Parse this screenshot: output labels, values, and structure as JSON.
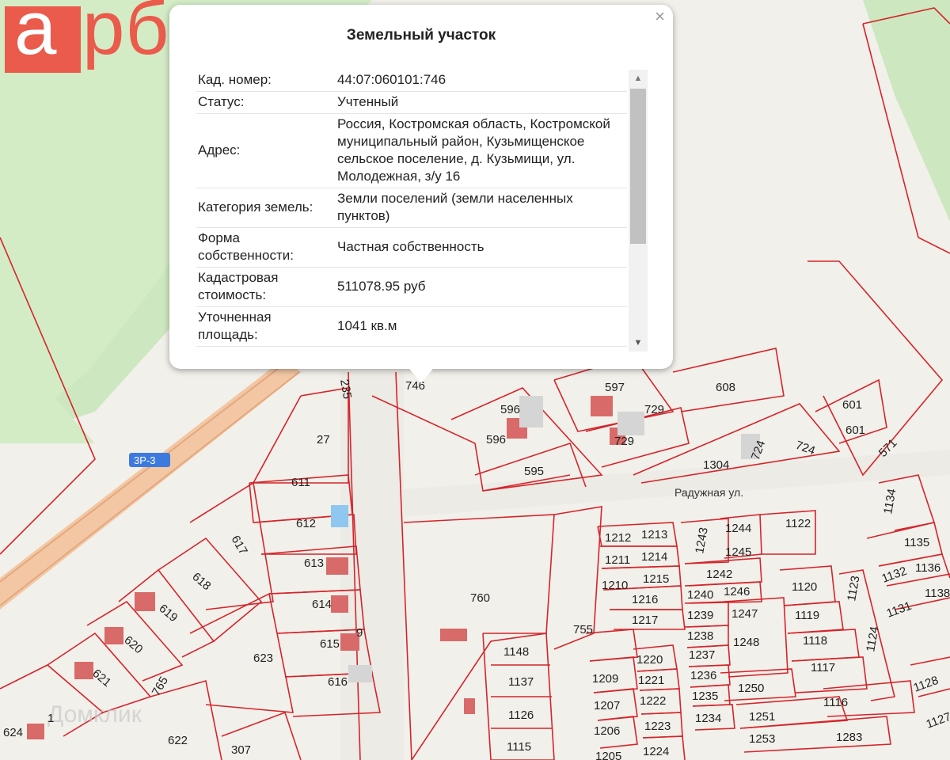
{
  "logo": {
    "first_letter": "а",
    "rest": "рбат"
  },
  "watermark": "Домклик",
  "popup": {
    "title": "Земельный участок",
    "close_glyph": "×",
    "rows": [
      {
        "key": "Кад. номер:",
        "value": "44:07:060101:746"
      },
      {
        "key": "Статус:",
        "value": "Учтенный"
      },
      {
        "key": "Адрес:",
        "value": "Россия, Костромская область, Костромской муниципальный район, Кузьмищенское сельское поселение, д. Кузьмищи, ул. Молодежная, з/у 16"
      },
      {
        "key": "Категория земель:",
        "value": "Земли поселений (земли населенных пунктов)"
      },
      {
        "key": "Форма собственности:",
        "value": "Частная собственность"
      },
      {
        "key": "Кадастровая стоимость:",
        "value": "511078.95 руб"
      },
      {
        "key": "Уточненная площадь:",
        "value": "1041 кв.м"
      }
    ]
  },
  "map": {
    "street": "Радужная ул.",
    "road_badge": "3Р-3",
    "plots": [
      "746",
      "235",
      "27",
      "611",
      "612",
      "613",
      "614",
      "615",
      "616",
      "617",
      "618",
      "619",
      "620",
      "621",
      "622",
      "623",
      "624",
      "307",
      "760",
      "755",
      "596",
      "596",
      "595",
      "597",
      "729",
      "729",
      "608",
      "601",
      "601",
      "724",
      "724",
      "1304",
      "571",
      "1134",
      "1135",
      "1136",
      "1138",
      "1132",
      "1131",
      "1128",
      "1127",
      "1212",
      "1213",
      "1211",
      "1214",
      "1210",
      "1215",
      "1216",
      "1217",
      "1243",
      "1244",
      "1245",
      "1122",
      "1242",
      "1240",
      "1246",
      "1239",
      "1247",
      "1238",
      "1237",
      "1248",
      "1236",
      "1235",
      "1250",
      "1234",
      "1251",
      "1253",
      "1116",
      "1283",
      "1120",
      "1119",
      "1118",
      "1117",
      "1123",
      "1124",
      "1148",
      "1137",
      "1126",
      "1115",
      "1209",
      "1207",
      "1206",
      "1205",
      "1220",
      "1221",
      "1222",
      "1223",
      "1224",
      "765",
      "1",
      "9"
    ]
  }
}
